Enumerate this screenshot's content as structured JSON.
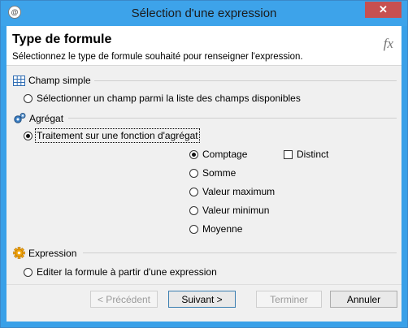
{
  "window": {
    "title": "Sélection d'une expression",
    "close_glyph": "✕"
  },
  "header": {
    "title": "Type de formule",
    "subtitle": "Sélectionnez le type de formule souhaité pour renseigner l'expression.",
    "fx_glyph": "fx"
  },
  "groups": {
    "champ": {
      "label": "Champ simple",
      "icon": "grid-icon",
      "option": "Sélectionner un champ parmi la liste des champs disponibles"
    },
    "agregat": {
      "label": "Agrégat",
      "icon": "gears-icon",
      "option": "Traitement sur une fonction d'agrégat",
      "functions": [
        "Comptage",
        "Somme",
        "Valeur maximum",
        "Valeur minimun",
        "Moyenne"
      ],
      "selected_function": "Comptage",
      "distinct_label": "Distinct",
      "distinct_checked": false
    },
    "expression": {
      "label": "Expression",
      "icon": "gear-orange-icon",
      "option": "Editer la formule à partir d'une expression"
    }
  },
  "selected_type": "agregat",
  "buttons": {
    "prev": "< Précédent",
    "next": "Suivant >",
    "finish": "Terminer",
    "cancel": "Annuler"
  },
  "colors": {
    "titlebar": "#3da3ea",
    "close": "#c75050",
    "group_icon_blue": "#2f6db3",
    "group_icon_orange": "#f0a30a"
  }
}
